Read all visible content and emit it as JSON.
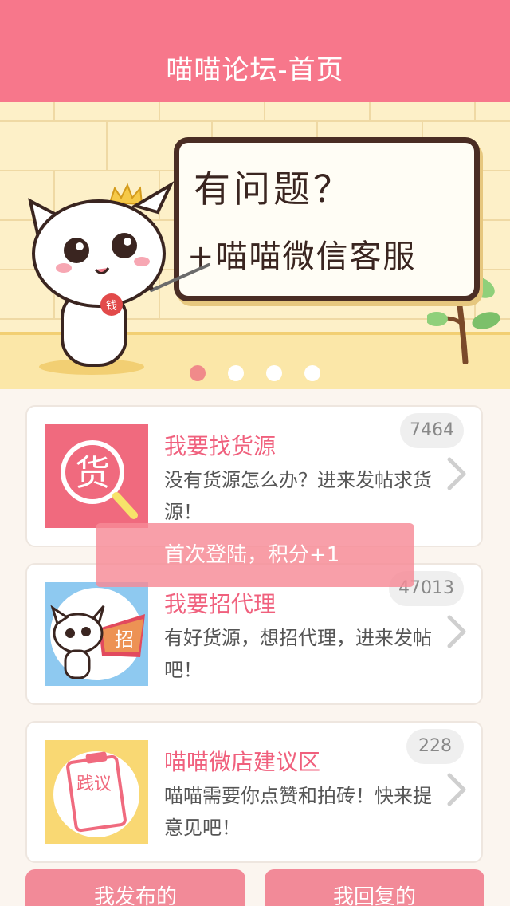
{
  "header": {
    "title": "喵喵论坛-首页"
  },
  "banner": {
    "line1": "有问题？",
    "line2": "+喵喵微信客服",
    "badge": "钱",
    "carousel": {
      "count": 4,
      "active": 0
    }
  },
  "forums": [
    {
      "title": "我要找货源",
      "desc": "没有货源怎么办？进来发帖求货源！",
      "count": "7464",
      "icon_text": "货"
    },
    {
      "title": "我要招代理",
      "desc": "有好货源，想招代理，进来发帖吧！",
      "count": "47013",
      "icon_text": "招"
    },
    {
      "title": "喵喵微店建议区",
      "desc": "喵喵需要你点赞和拍砖！快来提意见吧！",
      "count": "228",
      "icon_text": "践议"
    }
  ],
  "toast": {
    "text": "首次登陆，积分+1"
  },
  "bottom_tabs": {
    "my_posts": "我发布的",
    "my_replies": "我回复的"
  },
  "colors": {
    "brand": "#f7778b",
    "title_pink": "#f0607d",
    "background": "#fbf5ef"
  }
}
